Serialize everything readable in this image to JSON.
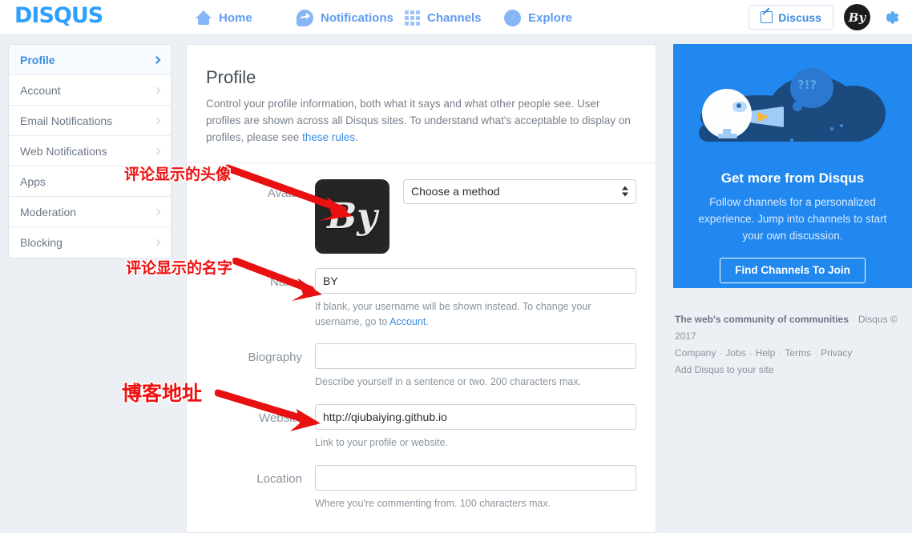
{
  "nav": {
    "logo": "DISQUS",
    "items": [
      {
        "label": "Home",
        "icon": "home-icon"
      },
      {
        "label": "Notifications",
        "icon": "notification-bubble-icon"
      },
      {
        "label": "Channels",
        "icon": "grid-icon"
      },
      {
        "label": "Explore",
        "icon": "compass-icon"
      }
    ],
    "discuss_label": "Discuss",
    "discuss_icon": "pencil-square-icon",
    "avatar_initials": "By",
    "gear_icon": "gear-icon"
  },
  "sidebar": {
    "items": [
      {
        "label": "Profile",
        "active": true
      },
      {
        "label": "Account",
        "active": false
      },
      {
        "label": "Email Notifications",
        "active": false
      },
      {
        "label": "Web Notifications",
        "active": false
      },
      {
        "label": "Apps",
        "active": false
      },
      {
        "label": "Moderation",
        "active": false
      },
      {
        "label": "Blocking",
        "active": false
      }
    ]
  },
  "main": {
    "title": "Profile",
    "description_before": "Control your profile information, both what it says and what other people see. User profiles are shown across all Disqus sites. To understand what's acceptable to display on profiles, please see ",
    "description_link": "these rules",
    "description_after": ".",
    "avatar": {
      "label": "Avatar",
      "initials": "By",
      "method_value": "Choose a method"
    },
    "fields": [
      {
        "label": "Name",
        "value": "BY",
        "placeholder": "",
        "help_before": "If blank, your username will be shown instead. To change your username, go to ",
        "help_link": "Account",
        "help_after": "."
      },
      {
        "label": "Biography",
        "value": "",
        "placeholder": "",
        "help_before": "Describe yourself in a sentence or two. 200 characters max.",
        "help_link": "",
        "help_after": ""
      },
      {
        "label": "Website",
        "value": "http://qiubaiying.github.io",
        "placeholder": "",
        "help_before": "Link to your profile or website.",
        "help_link": "",
        "help_after": ""
      },
      {
        "label": "Location",
        "value": "",
        "placeholder": "",
        "help_before": "Where you're commenting from. 100 characters max.",
        "help_link": "",
        "help_after": ""
      }
    ]
  },
  "promo": {
    "title": "Get more from Disqus",
    "text": "Follow channels for a personalized experience. Jump into channels to start your own discussion.",
    "button": "Find Channels To Join",
    "speech_bubble": "?!?"
  },
  "footer": {
    "tagline": "The web's community of communities",
    "copyright": "Disqus © 2017",
    "links": [
      "Company",
      "Jobs",
      "Help",
      "Terms",
      "Privacy"
    ],
    "add_link": "Add Disqus to your site"
  },
  "annotations": [
    {
      "text": "评论显示的头像"
    },
    {
      "text": "评论显示的名字"
    },
    {
      "text": "博客地址"
    }
  ],
  "colors": {
    "brand_blue": "#2e9fff",
    "nav_blue": "#5f9bf0",
    "link_blue": "#3b8ce0",
    "promo_blue": "#2188f0",
    "annotation_red": "#ee1111",
    "page_bg": "#eceff3"
  }
}
